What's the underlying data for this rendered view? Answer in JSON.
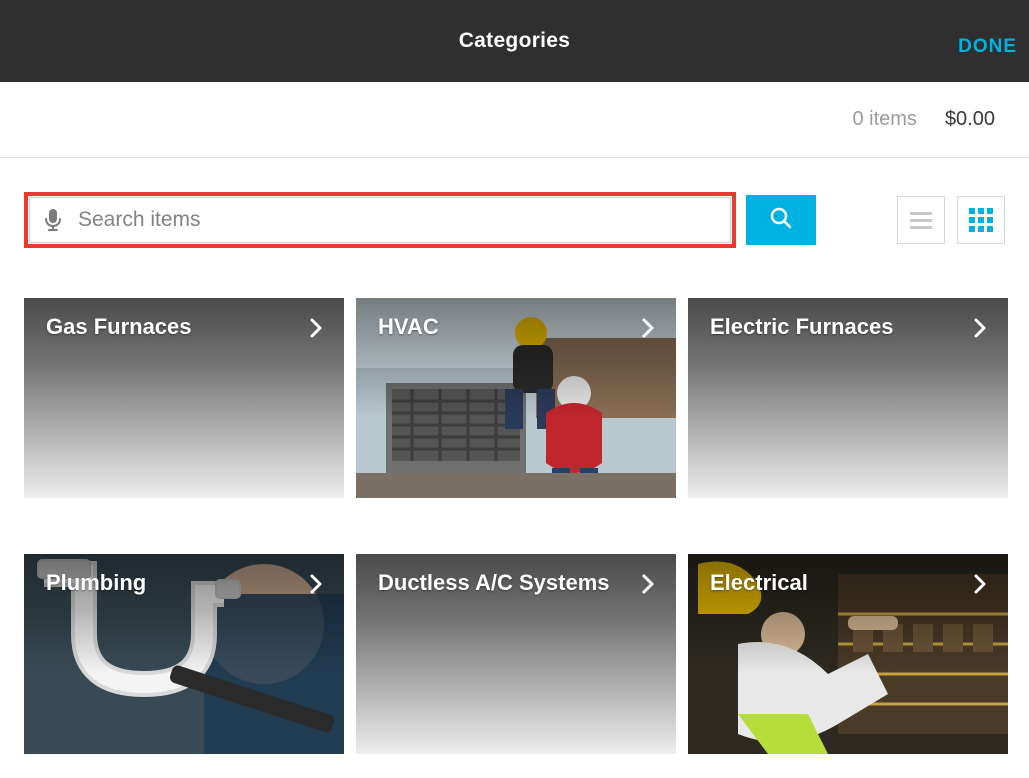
{
  "header": {
    "title": "Categories",
    "done_label": "DONE"
  },
  "cart": {
    "items_text": "0 items",
    "total_text": "$0.00"
  },
  "search": {
    "placeholder": "Search items"
  },
  "categories": [
    {
      "label": "Gas Furnaces",
      "has_image": false,
      "image": "none"
    },
    {
      "label": "HVAC",
      "has_image": true,
      "image": "hvac"
    },
    {
      "label": "Electric Furnaces",
      "has_image": false,
      "image": "none"
    },
    {
      "label": "Plumbing",
      "has_image": true,
      "image": "plumbing"
    },
    {
      "label": "Ductless A/C Systems",
      "has_image": false,
      "image": "none"
    },
    {
      "label": "Electrical",
      "has_image": true,
      "image": "electrical"
    }
  ],
  "highlight": {
    "target": "search-input",
    "color": "#e63b2e"
  }
}
